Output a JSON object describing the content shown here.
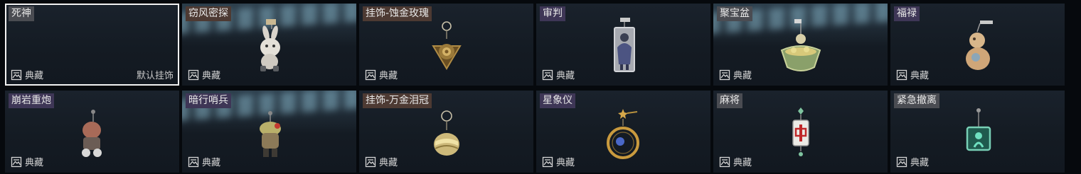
{
  "items": [
    {
      "name": "死神",
      "collection": "典藏",
      "default_label": "默认挂饰",
      "charm_icon": "empty-slot"
    },
    {
      "name": "窃风密探",
      "collection": "典藏",
      "charm_icon": "rabbit-charm-icon"
    },
    {
      "name": "挂饰-蚀金玫瑰",
      "collection": "典藏",
      "charm_icon": "gold-rose-charm-icon"
    },
    {
      "name": "审判",
      "collection": "典藏",
      "charm_icon": "judgment-card-charm-icon"
    },
    {
      "name": "聚宝盆",
      "collection": "典藏",
      "charm_icon": "treasure-bowl-charm-icon"
    },
    {
      "name": "福禄",
      "collection": "典藏",
      "charm_icon": "gourd-charm-icon"
    },
    {
      "name": "崩岩重炮",
      "collection": "典藏",
      "charm_icon": "mushroom-cannon-charm-icon"
    },
    {
      "name": "暗行哨兵",
      "collection": "典藏",
      "charm_icon": "sentinel-charm-icon"
    },
    {
      "name": "挂饰-万金泪冠",
      "collection": "典藏",
      "charm_icon": "gold-crown-charm-icon"
    },
    {
      "name": "星象仪",
      "collection": "典藏",
      "charm_icon": "astrolabe-charm-icon"
    },
    {
      "name": "麻将",
      "collection": "典藏",
      "charm_icon": "mahjong-tile-charm-icon"
    },
    {
      "name": "紧急撤离",
      "collection": "典藏",
      "charm_icon": "jade-tile-charm-icon"
    }
  ],
  "colors": {
    "selected_border": "#f2f2f2",
    "card_bg": "#161d25",
    "page_bg": "#06090d"
  }
}
